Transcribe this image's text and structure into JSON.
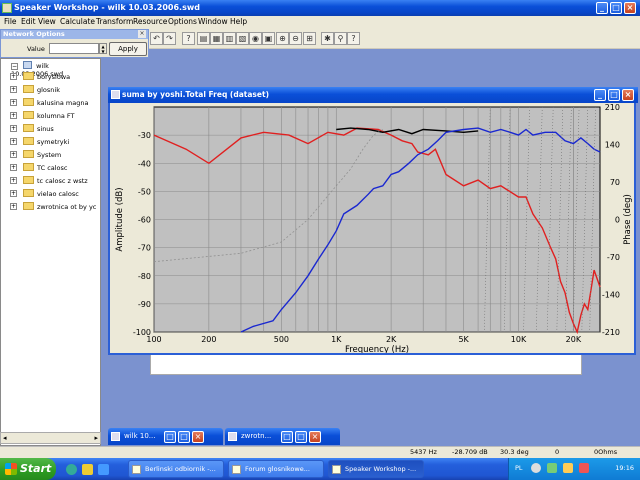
{
  "app": {
    "title": "Speaker Workshop - wilk 10.03.2006.swd"
  },
  "menu": [
    "File",
    "Edit",
    "View",
    "Calculate",
    "Transform",
    "Resource",
    "Options",
    "Window",
    "Help"
  ],
  "network_options": {
    "title": "Network Options",
    "value_label": "Value",
    "value": "",
    "apply_label": "Apply"
  },
  "tree": {
    "root": "wilk 10.03.2006.swd",
    "items": [
      "boryslowa",
      "glosnik",
      "kalusina magna",
      "kolumna FT",
      "sinus",
      "symetryki",
      "System",
      "TC calosc",
      "tc calosc z wstz",
      "vielao calosc",
      "zwrotnica ot by yc"
    ]
  },
  "chart_window": {
    "title": "suma by yoshi.Total Freq (dataset)"
  },
  "chart_data": {
    "type": "line",
    "xlabel": "Frequency (Hz)",
    "ylabel": "Amplitude (dB)",
    "y2label": "Phase (deg)",
    "x_scale": "log",
    "xlim": [
      100,
      28000
    ],
    "ylim": [
      -100,
      -20
    ],
    "y2lim": [
      -210,
      210
    ],
    "grid": true,
    "x_ticks": [
      "100",
      "200",
      "500",
      "1K",
      "2K",
      "5K",
      "10K",
      "20K"
    ],
    "x_tick_values": [
      100,
      200,
      500,
      1000,
      2000,
      5000,
      10000,
      20000
    ],
    "y_ticks": [
      "-30",
      "-40",
      "-50",
      "-60",
      "-70",
      "-80",
      "-90",
      "-100"
    ],
    "y_tick_values": [
      -30,
      -40,
      -50,
      -60,
      -70,
      -80,
      -90,
      -100
    ],
    "y2_ticks": [
      "210",
      "140",
      "70",
      "0",
      "-70",
      "-140",
      "-210"
    ],
    "y2_tick_values": [
      210,
      140,
      70,
      0,
      -70,
      -140,
      -210
    ],
    "series": [
      {
        "color": "#e02020",
        "points": [
          [
            100,
            -30
          ],
          [
            150,
            -35
          ],
          [
            200,
            -40
          ],
          [
            300,
            -31
          ],
          [
            400,
            -29
          ],
          [
            550,
            -30
          ],
          [
            700,
            -33
          ],
          [
            900,
            -29
          ],
          [
            1100,
            -30
          ],
          [
            1300,
            -27.5
          ],
          [
            1700,
            -28
          ],
          [
            2000,
            -30
          ],
          [
            2300,
            -32
          ],
          [
            2600,
            -33
          ],
          [
            2800,
            -36
          ],
          [
            3200,
            -37
          ],
          [
            3500,
            -35
          ],
          [
            4000,
            -44
          ],
          [
            5000,
            -48
          ],
          [
            6000,
            -46
          ],
          [
            7000,
            -49
          ],
          [
            8000,
            -48
          ],
          [
            10000,
            -52
          ],
          [
            11000,
            -52
          ],
          [
            12000,
            -58
          ],
          [
            13500,
            -63
          ],
          [
            15000,
            -70
          ],
          [
            16000,
            -74
          ],
          [
            17000,
            -82
          ],
          [
            18000,
            -86
          ],
          [
            19000,
            -93
          ],
          [
            20000,
            -97
          ],
          [
            21000,
            -100
          ],
          [
            22000,
            -94
          ],
          [
            23000,
            -90
          ],
          [
            24000,
            -92
          ],
          [
            25000,
            -85
          ],
          [
            26000,
            -78
          ],
          [
            28000,
            -84
          ]
        ]
      },
      {
        "color": "#000000",
        "points": [
          [
            1000,
            -28
          ],
          [
            1200,
            -27.5
          ],
          [
            1500,
            -28
          ],
          [
            1800,
            -29
          ],
          [
            2200,
            -28
          ],
          [
            2600,
            -29.5
          ],
          [
            3000,
            -28
          ],
          [
            4000,
            -28.5
          ],
          [
            5000,
            -29
          ],
          [
            6000,
            -28.5
          ]
        ]
      },
      {
        "color": "#1a28d0",
        "points": [
          [
            300,
            -100
          ],
          [
            350,
            -98
          ],
          [
            450,
            -96
          ],
          [
            500,
            -92
          ],
          [
            600,
            -86
          ],
          [
            700,
            -80
          ],
          [
            800,
            -74
          ],
          [
            900,
            -69
          ],
          [
            1000,
            -64
          ],
          [
            1100,
            -58
          ],
          [
            1300,
            -55
          ],
          [
            1500,
            -51
          ],
          [
            1600,
            -49
          ],
          [
            1800,
            -48
          ],
          [
            2000,
            -44
          ],
          [
            2200,
            -43
          ],
          [
            2500,
            -40
          ],
          [
            2800,
            -37
          ],
          [
            3200,
            -35
          ],
          [
            3600,
            -32
          ],
          [
            4000,
            -29
          ],
          [
            5000,
            -28
          ],
          [
            6000,
            -27.5
          ],
          [
            7000,
            -29
          ],
          [
            8000,
            -28
          ],
          [
            9000,
            -29
          ],
          [
            10000,
            -30
          ],
          [
            11000,
            -28
          ],
          [
            12000,
            -30
          ],
          [
            14000,
            -29
          ],
          [
            16000,
            -29
          ],
          [
            18000,
            -32
          ],
          [
            20000,
            -33
          ],
          [
            22000,
            -31
          ],
          [
            24000,
            -33
          ],
          [
            26000,
            -35
          ],
          [
            28000,
            -36
          ]
        ]
      },
      {
        "color": "#909090",
        "dashed": true,
        "points": [
          [
            100,
            -75
          ],
          [
            300,
            -72
          ],
          [
            500,
            -68
          ],
          [
            700,
            -60
          ],
          [
            1000,
            -48
          ],
          [
            1200,
            -42
          ],
          [
            1400,
            -35
          ],
          [
            1600,
            -30
          ],
          [
            1800,
            -28
          ]
        ]
      }
    ]
  },
  "minimized": [
    {
      "title": "wilk 10..."
    },
    {
      "title": "zwrotn..."
    }
  ],
  "status": [
    "5437 Hz",
    "-28.709 dB",
    "30.3 deg",
    "0",
    "0Ohms"
  ],
  "taskbar": {
    "start_label": "Start",
    "tasks": [
      "Berlinski odbiornik -...",
      "Forum glosnikowe...",
      "Speaker Workshop -..."
    ],
    "clock": "19:16"
  }
}
